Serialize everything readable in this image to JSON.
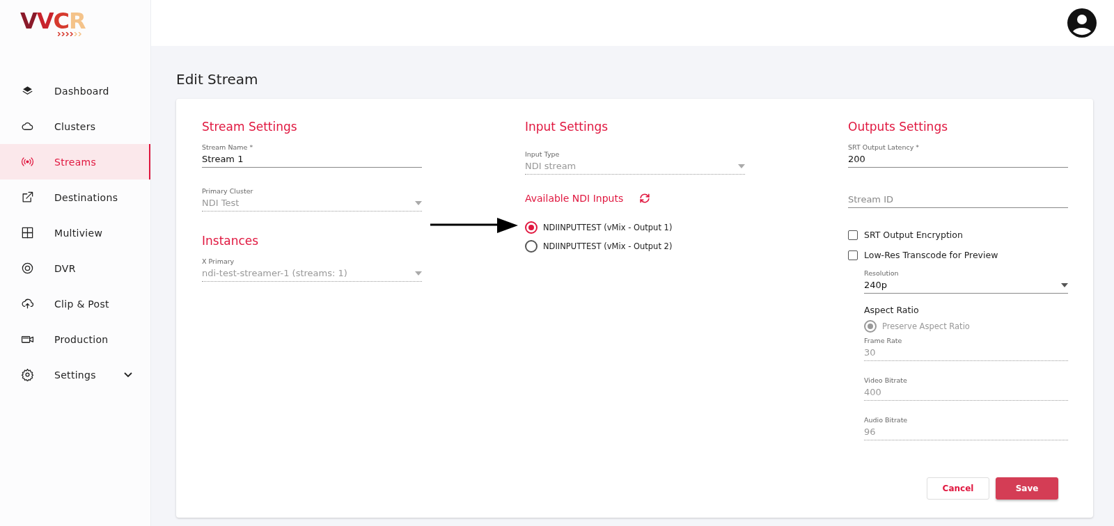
{
  "logo": {
    "text": "VVCR"
  },
  "sidebar": {
    "items": [
      {
        "label": "Dashboard",
        "selected": false
      },
      {
        "label": "Clusters",
        "selected": false
      },
      {
        "label": "Streams",
        "selected": true
      },
      {
        "label": "Destinations",
        "selected": false
      },
      {
        "label": "Multiview",
        "selected": false
      },
      {
        "label": "DVR",
        "selected": false
      },
      {
        "label": "Clip & Post",
        "selected": false
      },
      {
        "label": "Production",
        "selected": false
      },
      {
        "label": "Settings",
        "selected": false,
        "expanded": false
      }
    ]
  },
  "page": {
    "title": "Edit Stream"
  },
  "stream_settings": {
    "title": "Stream Settings",
    "fields": [
      {
        "label": "Stream Name *",
        "value": "Stream 1",
        "disabled": false
      },
      {
        "kind": "select",
        "label": "Primary Cluster",
        "value": "NDI Test",
        "disabled": true
      }
    ]
  },
  "instances": {
    "title": "Instances",
    "fields": [
      {
        "kind": "select",
        "label": "X Primary",
        "value": "ndi-test-streamer-1 (streams: 1)",
        "disabled": true
      }
    ]
  },
  "input_settings": {
    "title": "Input Settings",
    "fields": [
      {
        "kind": "select",
        "label": "Input Type",
        "value": "NDI stream",
        "disabled": true
      }
    ],
    "ndi_title": "Available NDI Inputs",
    "ndi_inputs": [
      {
        "label": "NDIINPUTTEST (vMix - Output 1)",
        "selected": true
      },
      {
        "label": "NDIINPUTTEST (vMix - Output 2)",
        "selected": false
      }
    ]
  },
  "outputs_settings": {
    "title": "Outputs Settings",
    "fields": [
      {
        "label": "SRT Output Latency *",
        "value": "200",
        "disabled": false
      },
      {
        "placeholder": "Stream ID",
        "disabled": false
      }
    ],
    "checkboxes": [
      {
        "label": "SRT Output Encryption",
        "checked": false
      },
      {
        "label": "Low-Res Transcode for Preview",
        "checked": false
      }
    ],
    "resolution": {
      "kind": "select",
      "label": "Resolution",
      "value": "240p",
      "disabled": false
    },
    "aspect_ratio": {
      "title": "Aspect Ratio",
      "options": [
        {
          "label": "Preserve Aspect Ratio",
          "selected": true,
          "disabled": true
        }
      ]
    },
    "more_fields": [
      {
        "label": "Frame Rate",
        "value": "30",
        "disabled": true
      },
      {
        "label": "Video Bitrate",
        "value": "400",
        "disabled": true
      },
      {
        "label": "Audio Bitrate",
        "value": "96",
        "disabled": true
      }
    ]
  },
  "buttons": [
    {
      "label": "Cancel",
      "kind": "secondary"
    },
    {
      "label": "Save",
      "kind": "primary"
    }
  ]
}
